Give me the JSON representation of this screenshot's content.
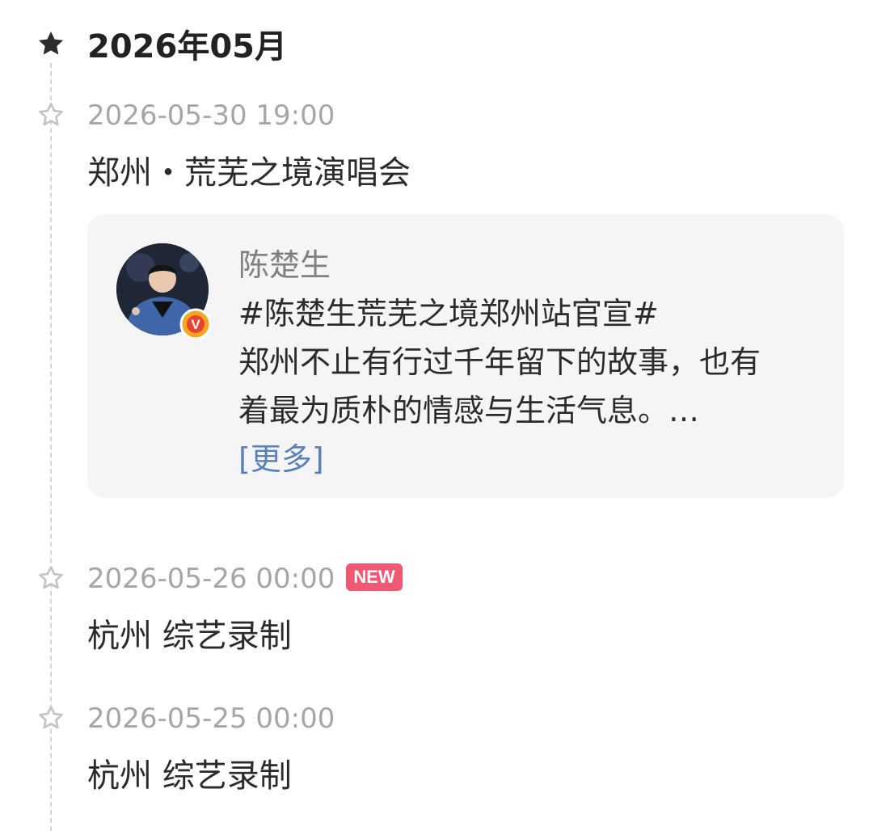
{
  "timeline": {
    "month_label": "2026年05月",
    "events": [
      {
        "datetime": "2026-05-30 19:00",
        "title": "郑州・荒芜之境演唱会",
        "post": {
          "author": "陈楚生",
          "hashtag": "#陈楚生荒芜之境郑州站官宣#",
          "body_line1": "郑州不止有行过千年留下的故事，也有",
          "body_line2": "着最为质朴的情感与生活气息。…",
          "more_link": "[更多]",
          "verified_badge": "V"
        }
      },
      {
        "datetime": "2026-05-26 00:00",
        "badge": "NEW",
        "title": "杭州 综艺录制"
      },
      {
        "datetime": "2026-05-25 00:00",
        "title": "杭州 综艺录制"
      }
    ]
  },
  "icons": {
    "month_marker": "star-filled-icon",
    "event_marker": "star-outline-icon"
  },
  "colors": {
    "title_text": "#222222",
    "time_text": "#a6a6a6",
    "link": "#5b82b8",
    "new_badge": "#f05873",
    "card_bg": "#f5f5f5",
    "verified_badge": "#f5a623"
  }
}
